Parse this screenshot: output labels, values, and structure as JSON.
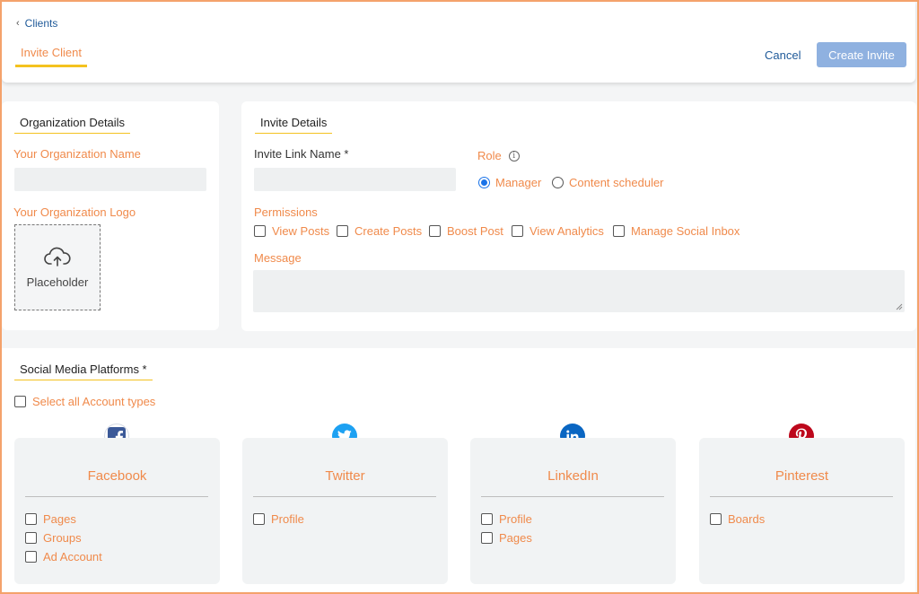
{
  "header": {
    "back_label": "Clients",
    "active_tab": "Invite Client",
    "cancel_label": "Cancel",
    "create_label": "Create Invite"
  },
  "org": {
    "section_title": "Organization Details",
    "name_label": "Your Organization Name",
    "name_value": "",
    "logo_label": "Your Organization Logo",
    "logo_placeholder": "Placeholder"
  },
  "invite": {
    "section_title": "Invite Details",
    "link_name_label": "Invite Link Name *",
    "link_name_value": "",
    "role_label": "Role",
    "roles": [
      {
        "label": "Manager",
        "selected": true
      },
      {
        "label": "Content scheduler",
        "selected": false
      }
    ],
    "permissions_label": "Permissions",
    "permissions": [
      "View Posts",
      "Create Posts",
      "Boost Post",
      "View Analytics",
      "Manage Social Inbox"
    ],
    "message_label": "Message",
    "message_value": ""
  },
  "social": {
    "section_title": "Social Media Platforms *",
    "select_all_label": "Select all Account types",
    "platforms": [
      {
        "name": "Facebook",
        "color": "#3b5998",
        "options": [
          "Pages",
          "Groups",
          "Ad Account"
        ]
      },
      {
        "name": "Twitter",
        "color": "#1da1f2",
        "options": [
          "Profile"
        ]
      },
      {
        "name": "LinkedIn",
        "color": "#0a66c2",
        "options": [
          "Profile",
          "Pages"
        ]
      },
      {
        "name": "Pinterest",
        "color": "#bd081c",
        "options": [
          "Boards"
        ]
      }
    ]
  },
  "colors": {
    "accent_orange": "#f08a4b",
    "underline_yellow": "#f4c21f",
    "link_blue": "#1f5a99",
    "button_blue": "#8fb1e0"
  }
}
